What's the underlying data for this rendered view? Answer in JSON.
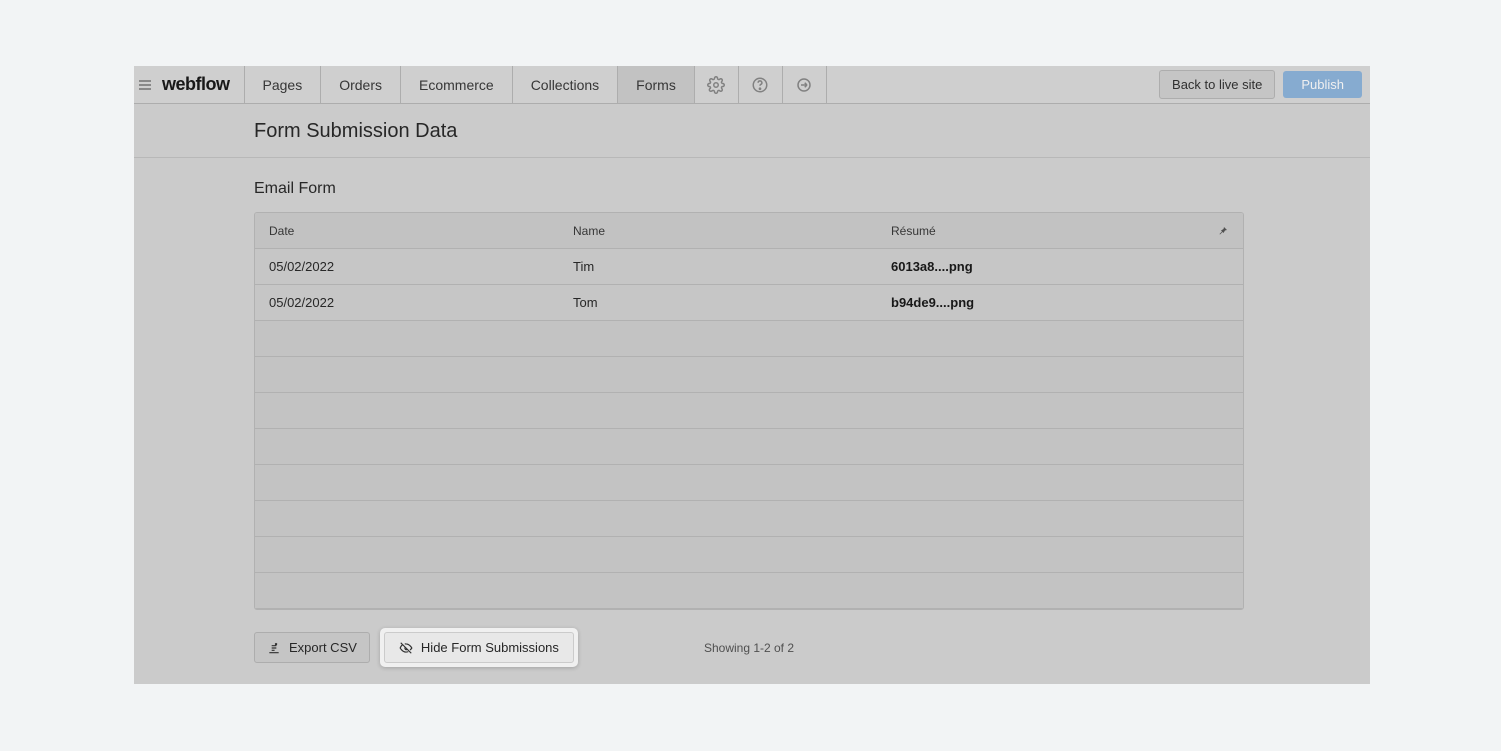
{
  "brand": "webflow",
  "nav": {
    "pages": "Pages",
    "orders": "Orders",
    "ecommerce": "Ecommerce",
    "collections": "Collections",
    "forms": "Forms"
  },
  "buttons": {
    "back": "Back to live site",
    "publish": "Publish",
    "export": "Export CSV",
    "hide": "Hide Form Submissions"
  },
  "page": {
    "title": "Form Submission Data",
    "form_name": "Email Form",
    "showing": "Showing 1-2 of 2"
  },
  "table": {
    "headers": {
      "date": "Date",
      "name": "Name",
      "resume": "Résumé"
    },
    "rows": [
      {
        "date": "05/02/2022",
        "name": "Tim",
        "resume": "6013a8....png"
      },
      {
        "date": "05/02/2022",
        "name": "Tom",
        "resume": "b94de9....png"
      }
    ]
  }
}
